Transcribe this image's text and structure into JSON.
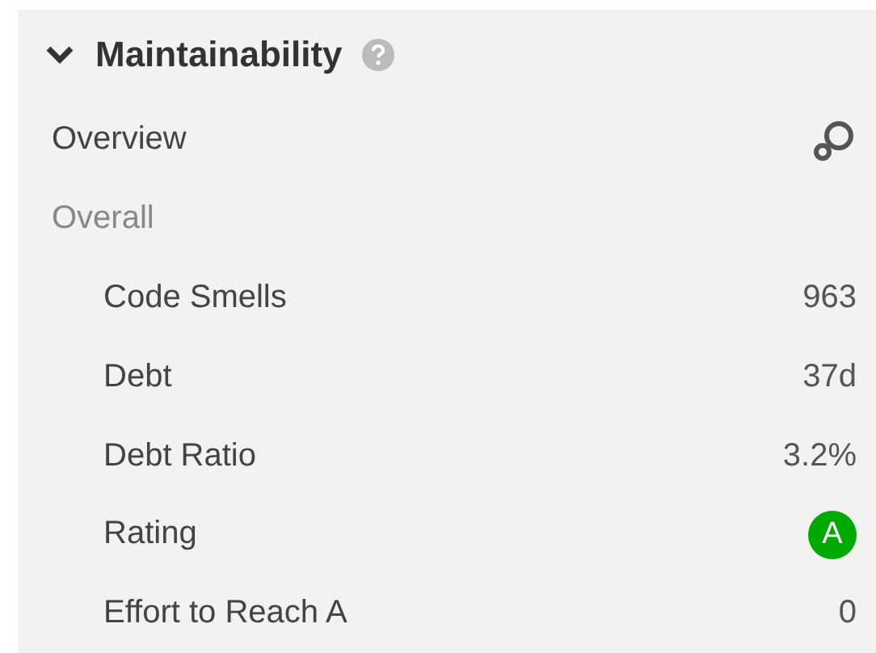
{
  "section": {
    "title": "Maintainability",
    "expanded": true
  },
  "overview": {
    "label": "Overview"
  },
  "group": {
    "label": "Overall"
  },
  "metrics": [
    {
      "label": "Code Smells",
      "kind": "text",
      "value": "963"
    },
    {
      "label": "Debt",
      "kind": "text",
      "value": "37d"
    },
    {
      "label": "Debt Ratio",
      "kind": "text",
      "value": "3.2%"
    },
    {
      "label": "Rating",
      "kind": "badge",
      "value": "A",
      "color": "#00aa00"
    },
    {
      "label": "Effort to Reach A",
      "kind": "text",
      "value": "0"
    }
  ]
}
